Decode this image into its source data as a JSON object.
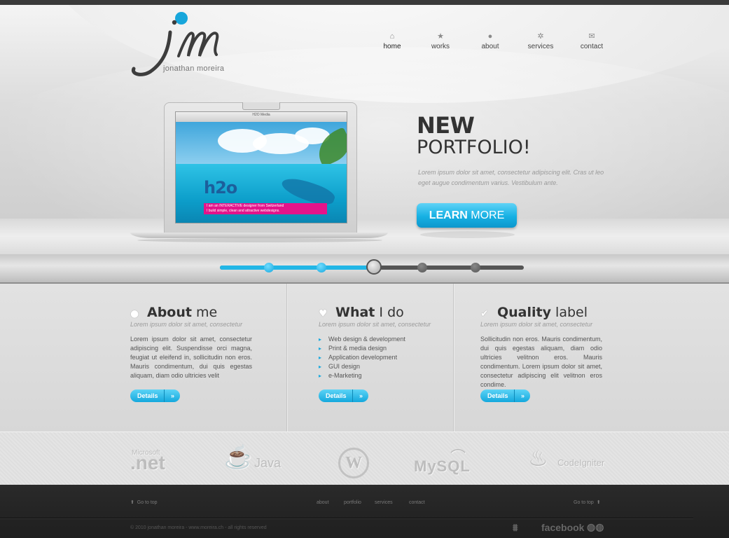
{
  "logo": {
    "name": "jonathan moreira",
    "mark": "jm"
  },
  "nav": [
    {
      "icon": "home-icon",
      "label": "home"
    },
    {
      "icon": "star-icon",
      "label": "works"
    },
    {
      "icon": "user-icon",
      "label": "about"
    },
    {
      "icon": "gear-icon",
      "label": "services"
    },
    {
      "icon": "envelope-icon",
      "label": "contact"
    }
  ],
  "hero": {
    "headline_bold": "NEW",
    "headline_regular": "PORTFOLIO!",
    "paragraph": "Lorem ipsum dolor sit amet, consectetur adipiscing elit. Cras ut leo eget augue condimentum varius. Vestibulum ante.",
    "button_bold": "LEARN",
    "button_regular": " MORE",
    "screen": {
      "window_title": "H2O Media",
      "logo_text": "h2o",
      "banner_line1": "I am an INTERACTIVE designer from Switzerland",
      "banner_line2": "I build simple, clean and attractive webdesigns."
    }
  },
  "slider": {
    "slide_count": 5,
    "active_slide": 3
  },
  "sections": {
    "about": {
      "title_bold": "About",
      "title_rest": " me",
      "subtitle": "Lorem ipsum dolor sit amet, consectetur",
      "text": "Lorem ipsum dolor sit amet, consectetur adipiscing elit. Suspendisse orci magna, feugiat ut eleifend in, sollicitudin non eros. Mauris condimentum, dui quis egestas aliquam, diam odio ultricies velit",
      "button": "Details",
      "button_arrow": "»"
    },
    "what": {
      "title_bold": "What",
      "title_rest": " I do",
      "subtitle": "Lorem ipsum dolor sit amet, consectetur",
      "items": [
        "Web design & development",
        "Print & media design",
        "Application development",
        "GUI design",
        "e-Marketing"
      ],
      "button": "Details",
      "button_arrow": "»"
    },
    "quality": {
      "title_bold": "Quality",
      "title_rest": " label",
      "subtitle": "Lorem ipsum dolor sit amet, consectetur",
      "text": "Sollicitudin non eros. Mauris condimentum, dui quis egestas aliquam, diam odio ultricies velitnon eros. Mauris condimentum. Lorem ipsum dolor sit amet, consectetur adipiscing elit velitnon eros condime.",
      "button": "Details",
      "button_arrow": "»"
    }
  },
  "tech_logos": {
    "net_small": "Microsoft",
    "net_big": ".net",
    "java": "Java",
    "wordpress": "W",
    "mysql": "MySQL",
    "codeigniter": "CodeIgniter"
  },
  "footer": {
    "go_top_left": "Go to top",
    "links": [
      "about",
      "portfolio",
      "services",
      "contact"
    ],
    "go_top_right": "Go to top",
    "copyright": "© 2010 jonathan moreira - www.moreira.ch - all rights reserved",
    "social": {
      "facebook": "facebook"
    }
  }
}
